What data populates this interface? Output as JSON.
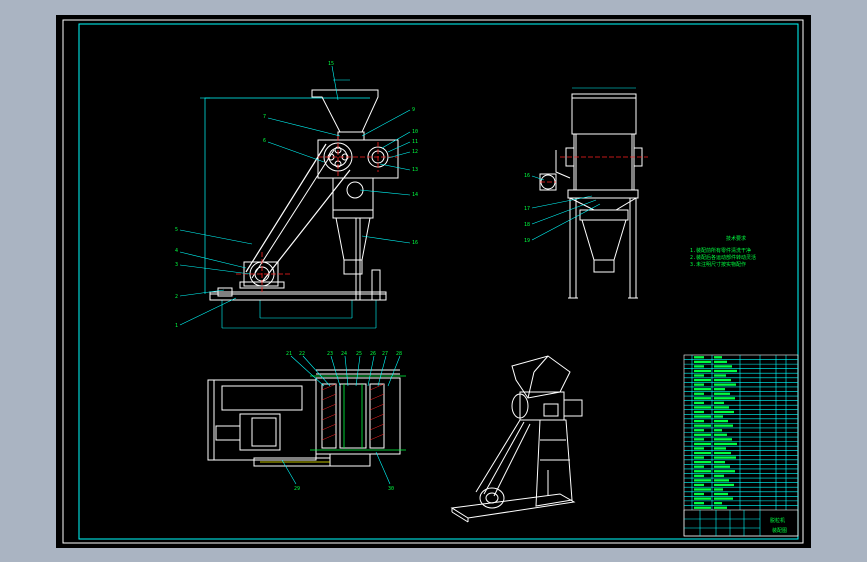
{
  "drawing": {
    "sheet_background": "#000000",
    "border_color": "#00ffff",
    "outer_frame_color": "#ffffff",
    "leader_color": "#00ffff",
    "part_color": "#ffffff",
    "centerline_color": "#ff2020",
    "text_color": "#00ff40",
    "front_view_balloons": [
      "15",
      "7",
      "6",
      "5",
      "4",
      "3",
      "2",
      "1",
      "9",
      "10",
      "11",
      "12",
      "13",
      "14",
      "16"
    ],
    "side_view_balloons": [
      "16",
      "17",
      "18",
      "19"
    ],
    "section_view_balloons": [
      "21",
      "22",
      "23",
      "24",
      "25",
      "26",
      "27",
      "28",
      "29",
      "30"
    ],
    "tech_title": "技术要求",
    "tech_notes": [
      "1.装配前所有零件清洗干净",
      "2.装配后各运动部件转动灵活",
      "3.未注明尺寸按实物配作"
    ],
    "bom_rows": 34,
    "title_block_name": "脱粒机",
    "title_block_sub": "装配图"
  }
}
